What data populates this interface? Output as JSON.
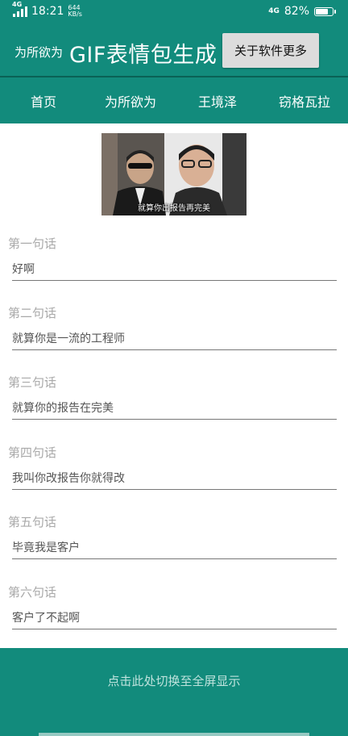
{
  "status": {
    "time": "18:21",
    "signal_tag": "4G",
    "speed_value": "644",
    "speed_unit": "KB/s",
    "network_right": "4G",
    "battery": "82%",
    "battery_level": 0.82
  },
  "header": {
    "prefix": "为所欲为",
    "title": "GIF表情包生成",
    "about_button": "关于软件更多"
  },
  "tabs": [
    {
      "label": "首页"
    },
    {
      "label": "为所欲为"
    },
    {
      "label": "王境泽"
    },
    {
      "label": "窃格瓦拉"
    }
  ],
  "preview": {
    "caption": "就算你出报告再完美"
  },
  "fields": [
    {
      "label": "第一句话",
      "value": "好啊"
    },
    {
      "label": "第二句话",
      "value": "就算你是一流的工程师"
    },
    {
      "label": "第三句话",
      "value": "就算你的报告在完美"
    },
    {
      "label": "第四句话",
      "value": "我叫你改报告你就得改"
    },
    {
      "label": "第五句话",
      "value": "毕竟我是客户"
    },
    {
      "label": "第六句话",
      "value": "客户了不起啊"
    }
  ],
  "footer": {
    "fullscreen_label": "点击此处切换至全屏显示"
  },
  "colors": {
    "primary": "#128b7c",
    "label_gray": "#a9a9a9"
  }
}
